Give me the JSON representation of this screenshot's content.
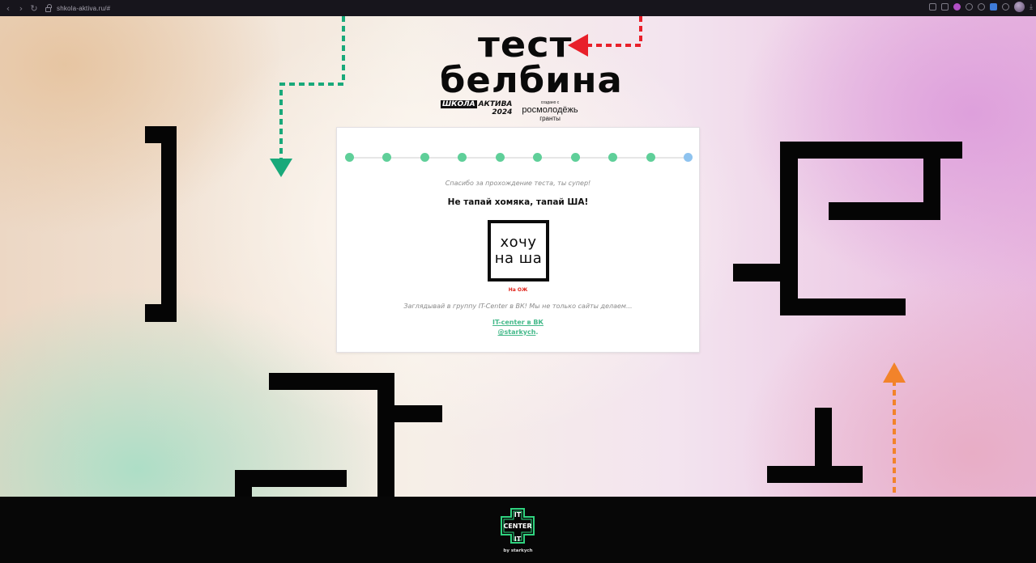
{
  "browser": {
    "url": "shkola-aktiva.ru/#",
    "nav": {
      "back": "‹",
      "forward": "›",
      "reload": "↻"
    },
    "extensions": [
      "reader-icon",
      "screenshot-icon",
      "pink-extension-icon",
      "play-icon",
      "heart-icon",
      "blue-extension-icon",
      "cube-icon",
      "profile-avatar",
      "download-icon"
    ]
  },
  "header": {
    "title_line1": "тест",
    "title_line2": "белбина",
    "shkola_box": "ШКОЛА",
    "shkola_word": "АКТИВА",
    "shkola_year": "2024",
    "created_with": "создано с",
    "rosmolodezh": "росмолодёжь",
    "granty": "гранты"
  },
  "card": {
    "progress_steps": 10,
    "current_step": 10,
    "thanks": "Спасибо за прохождение теста, ты супер!",
    "slogan": "Не тапай хомяка, тапай ША!",
    "logo_line1": "хочу",
    "logo_line2": "на ша",
    "logo_link": "На ОЖ",
    "peek_text": "Заглядывай в группу IT-Center в ВК! Мы не только сайты делаем...",
    "vk_link": "IT-center в ВК",
    "vk_handle": "@starkych"
  },
  "footer": {
    "logo_top": "IT",
    "logo_word": "CENTER",
    "byline": "by starkych"
  },
  "colors": {
    "green_arrow": "#19a97a",
    "red_arrow": "#e8202a",
    "orange_arrow": "#f2832a",
    "progress_done": "#5fcf99",
    "progress_current": "#8ec3ef",
    "link": "#44b98a",
    "footer_logo": "#2fd37f"
  }
}
